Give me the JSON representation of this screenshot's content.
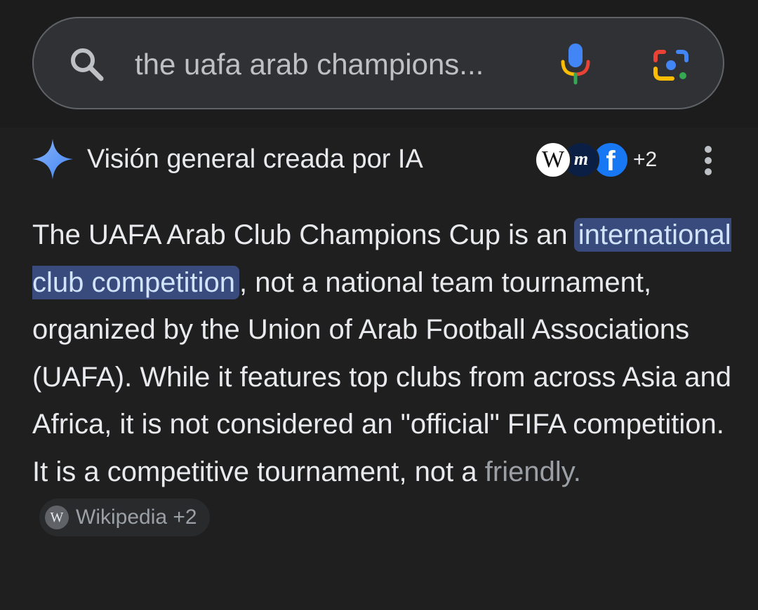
{
  "search": {
    "query": "the uafa arab champions..."
  },
  "icons": {
    "search": "search-icon",
    "mic": "microphone-icon",
    "lens": "google-lens-icon",
    "sparkle": "gemini-sparkle-icon",
    "menu": "more-vert-icon"
  },
  "ai_overview": {
    "title": "Visión general creada por IA",
    "source_avatars": [
      {
        "label": "W",
        "name": "Wikipedia"
      },
      {
        "label": "m",
        "name": "Wikimedia"
      },
      {
        "label": "f",
        "name": "Facebook"
      }
    ],
    "more_sources": "+2",
    "summary": {
      "lead": "The UAFA Arab Club Champions Cup is an ",
      "highlight": "international club competition",
      "middle": ", not a national team tournament, organized by the Union of Arab Football Associations (UAFA). While it features top clubs from across Asia and Africa, it is not considered an \"official\" FIFA competition. It is a competitive tournament, not a ",
      "faded": "friendly."
    },
    "citation": {
      "icon_letter": "W",
      "label": "Wikipedia",
      "more": "+2"
    }
  },
  "colors": {
    "background": "#1f1f1f",
    "search_bar": "#303134",
    "highlight": "#394a7c",
    "google_blue": "#4285f4",
    "google_red": "#ea4335",
    "google_yellow": "#fbbc04",
    "google_green": "#34a853"
  }
}
